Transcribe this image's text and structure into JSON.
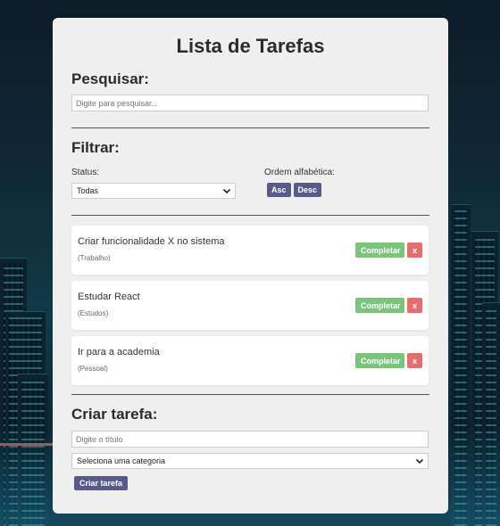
{
  "app": {
    "title": "Lista de Tarefas"
  },
  "search": {
    "heading": "Pesquisar:",
    "placeholder": "Digite para pesquisar...",
    "value": ""
  },
  "filter": {
    "heading": "Filtrar:",
    "status_label": "Status:",
    "status_value": "Todas",
    "sort_label": "Ordem alfabética:",
    "asc_label": "Asc",
    "desc_label": "Desc"
  },
  "tasks": [
    {
      "title": "Criar funcionalidade X no sistema",
      "category": "(Trabalho)",
      "complete_label": "Completar",
      "delete_label": "x"
    },
    {
      "title": "Estudar React",
      "category": "(Estudos)",
      "complete_label": "Completar",
      "delete_label": "x"
    },
    {
      "title": "Ir para a academia",
      "category": "(Pessoal)",
      "complete_label": "Completar",
      "delete_label": "x"
    }
  ],
  "create": {
    "heading": "Criar tarefa:",
    "title_placeholder": "Digite o título",
    "category_value": "Seleciona uma categoria",
    "submit_label": "Criar tarefa"
  },
  "colors": {
    "card_bg": "#efefef",
    "purple_button": "#5a5a8a",
    "green_button": "#7cc37c",
    "red_button": "#e07070"
  },
  "icons": {
    "dropdown": "chevron-down-icon",
    "background": "city-skyline-background"
  }
}
